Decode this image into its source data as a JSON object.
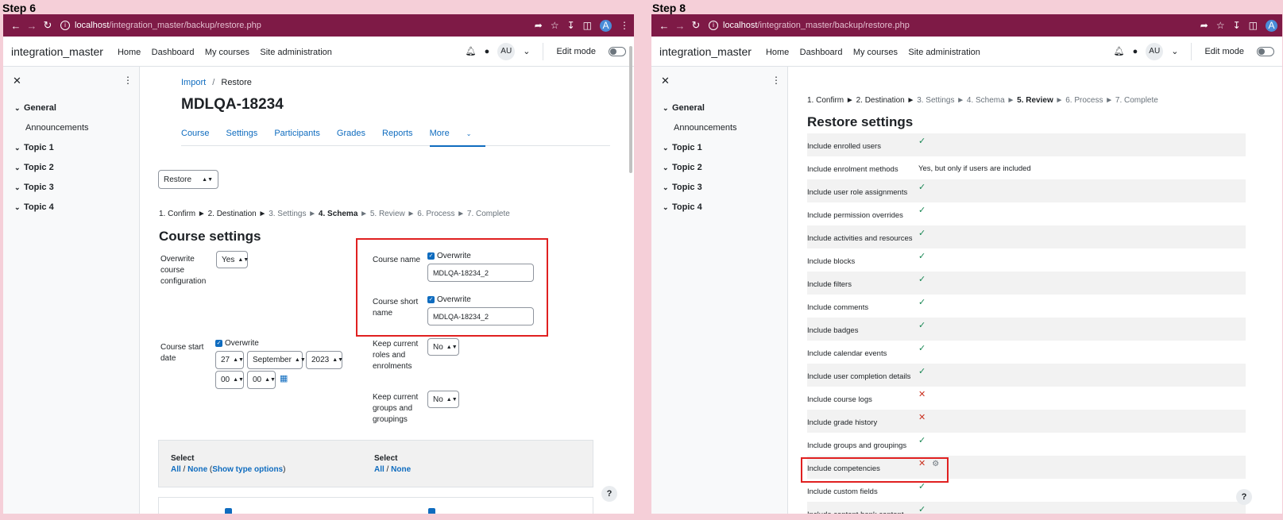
{
  "step6": {
    "label": "Step 6",
    "browser": {
      "url_host": "localhost",
      "url_path": "/integration_master/backup/restore.php"
    },
    "nav": {
      "brand": "integration_master",
      "links": [
        "Home",
        "Dashboard",
        "My courses",
        "Site administration"
      ],
      "user_initials": "AU",
      "edit_mode": "Edit mode"
    },
    "drawer": {
      "items": [
        {
          "label": "General",
          "type": "section"
        },
        {
          "label": "Announcements",
          "type": "sub"
        },
        {
          "label": "Topic 1",
          "type": "section"
        },
        {
          "label": "Topic 2",
          "type": "section"
        },
        {
          "label": "Topic 3",
          "type": "section"
        },
        {
          "label": "Topic 4",
          "type": "section"
        }
      ]
    },
    "breadcrumb": {
      "import": "Import",
      "sep": "/",
      "current": "Restore"
    },
    "course_title": "MDLQA-18234",
    "tabs": [
      "Course",
      "Settings",
      "Participants",
      "Grades",
      "Reports"
    ],
    "more_tab": "More",
    "restore_select": "Restore",
    "steps": {
      "done": "1. Confirm ► 2. Destination ► ",
      "pre": "3. Settings ► ",
      "current": "4. Schema",
      "future": " ► 5. Review ► 6. Process ► 7. Complete"
    },
    "course_settings_heading": "Course settings",
    "overwrite_config": {
      "label": "Overwrite course configuration",
      "value": "Yes"
    },
    "course_name": {
      "label": "Course name",
      "overwrite": "Overwrite",
      "value": "MDLQA-18234_2"
    },
    "course_short_name": {
      "label": "Course short name",
      "overwrite": "Overwrite",
      "value": "MDLQA-18234_2"
    },
    "start_date": {
      "label": "Course start date",
      "overwrite": "Overwrite",
      "day": "27",
      "month": "September",
      "year": "2023",
      "hour": "00",
      "minute": "00"
    },
    "keep_roles": {
      "label": "Keep current roles and enrolments",
      "value": "No"
    },
    "keep_groups": {
      "label": "Keep current groups and groupings",
      "value": "No"
    },
    "select_left": {
      "title": "Select",
      "all": "All",
      "slash": " / ",
      "none": "None",
      "open": " (",
      "type_opts": "Show type options",
      "close": ")"
    },
    "select_right": {
      "title": "Select",
      "all": "All",
      "slash": " / ",
      "none": "None"
    },
    "help": "?"
  },
  "step8": {
    "label": "Step 8",
    "browser": {
      "url_host": "localhost",
      "url_path": "/integration_master/backup/restore.php"
    },
    "nav": {
      "brand": "integration_master",
      "links": [
        "Home",
        "Dashboard",
        "My courses",
        "Site administration"
      ],
      "user_initials": "AU",
      "edit_mode": "Edit mode"
    },
    "drawer": {
      "items": [
        {
          "label": "General",
          "type": "section"
        },
        {
          "label": "Announcements",
          "type": "sub"
        },
        {
          "label": "Topic 1",
          "type": "section"
        },
        {
          "label": "Topic 2",
          "type": "section"
        },
        {
          "label": "Topic 3",
          "type": "section"
        },
        {
          "label": "Topic 4",
          "type": "section"
        }
      ]
    },
    "steps": {
      "done": "1. Confirm ► 2. Destination ► ",
      "pre": "3. Settings ► 4. Schema ► ",
      "current": "5. Review",
      "future": " ► 6. Process ► 7. Complete"
    },
    "heading": "Restore settings",
    "rows": [
      {
        "name": "Include enrolled users",
        "status": "yes"
      },
      {
        "name": "Include enrolment methods",
        "status": "text",
        "text": "Yes, but only if users are included"
      },
      {
        "name": "Include user role assignments",
        "status": "yes"
      },
      {
        "name": "Include permission overrides",
        "status": "yes"
      },
      {
        "name": "Include activities and resources",
        "status": "yes"
      },
      {
        "name": "Include blocks",
        "status": "yes"
      },
      {
        "name": "Include filters",
        "status": "yes"
      },
      {
        "name": "Include comments",
        "status": "yes"
      },
      {
        "name": "Include badges",
        "status": "yes"
      },
      {
        "name": "Include calendar events",
        "status": "yes"
      },
      {
        "name": "Include user completion details",
        "status": "yes"
      },
      {
        "name": "Include course logs",
        "status": "no"
      },
      {
        "name": "Include grade history",
        "status": "no"
      },
      {
        "name": "Include groups and groupings",
        "status": "yes"
      },
      {
        "name": "Include competencies",
        "status": "no",
        "locked": true
      },
      {
        "name": "Include custom fields",
        "status": "yes"
      },
      {
        "name": "Include content bank content",
        "status": "yes"
      }
    ],
    "help": "?"
  }
}
